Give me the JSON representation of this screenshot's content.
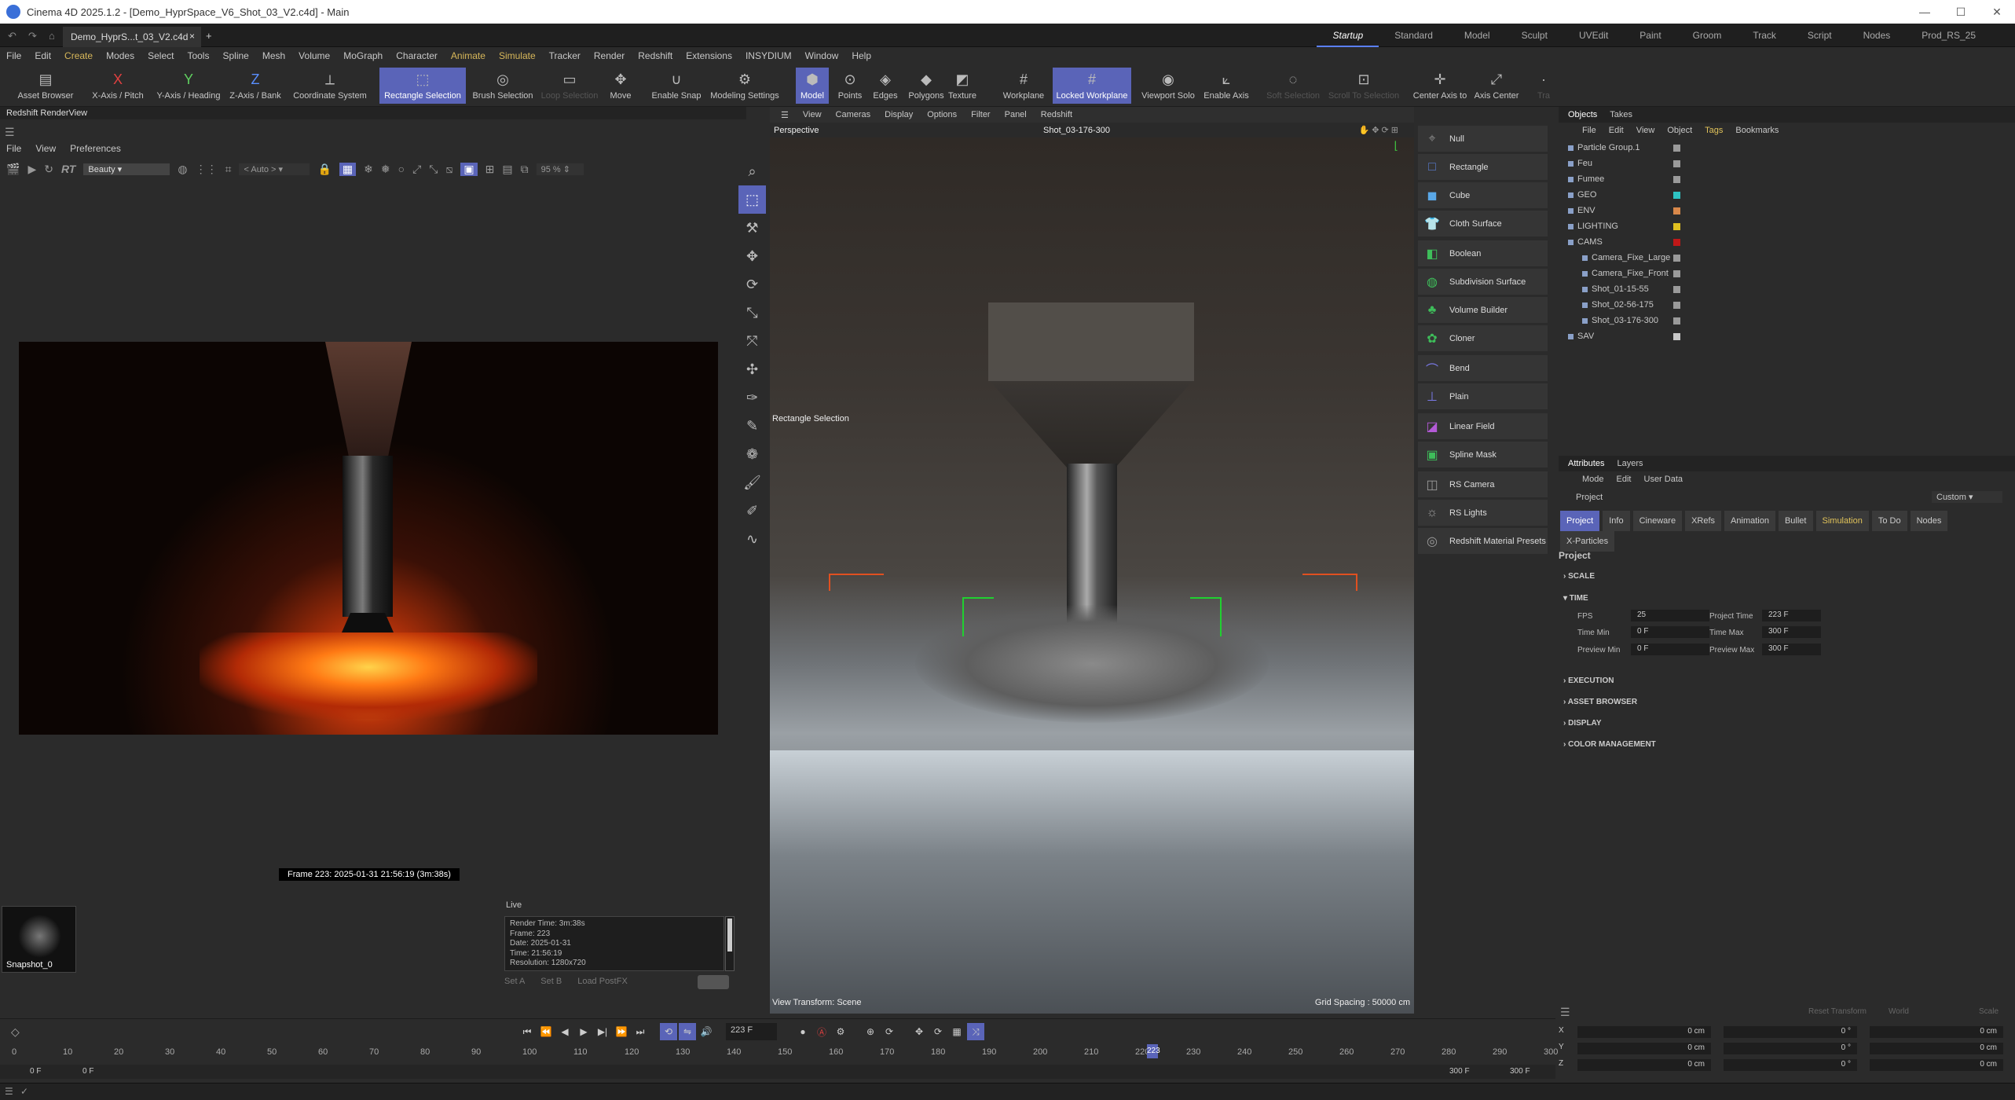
{
  "window": {
    "title": "Cinema 4D 2025.1.2 - [Demo_HyprSpace_V6_Shot_03_V2.c4d] - Main"
  },
  "doc_tab": {
    "label": "Demo_HyprS...t_03_V2.c4d",
    "close": "×",
    "add": "+"
  },
  "layouts": [
    "Startup",
    "Standard",
    "Model",
    "Sculpt",
    "UVEdit",
    "Paint",
    "Groom",
    "Track",
    "Script",
    "Nodes",
    "Prod_RS_25"
  ],
  "menu": [
    "File",
    "Edit",
    "Create",
    "Modes",
    "Select",
    "Tools",
    "Spline",
    "Mesh",
    "Volume",
    "MoGraph",
    "Character",
    "Animate",
    "Simulate",
    "Tracker",
    "Render",
    "Redshift",
    "Extensions",
    "INSYDIUM",
    "Window",
    "Help"
  ],
  "toolbar": [
    {
      "label": "Asset Browser",
      "icon": "asset-browser-icon",
      "glyph": "▤"
    },
    {
      "label": "X-Axis / Pitch",
      "icon": "x-axis-icon",
      "glyph": "X"
    },
    {
      "label": "Y-Axis / Heading",
      "icon": "y-axis-icon",
      "glyph": "Y"
    },
    {
      "label": "Z-Axis / Bank",
      "icon": "z-axis-icon",
      "glyph": "Z"
    },
    {
      "label": "Coordinate System",
      "icon": "coordinate-system-icon",
      "glyph": "⟂"
    },
    {
      "label": "Rectangle Selection",
      "icon": "rectangle-selection-icon",
      "glyph": "⬚"
    },
    {
      "label": "Brush Selection",
      "icon": "brush-selection-icon",
      "glyph": "◎"
    },
    {
      "label": "Loop Selection",
      "icon": "loop-selection-icon",
      "glyph": "▭"
    },
    {
      "label": "Move",
      "icon": "move-icon",
      "glyph": "✥"
    },
    {
      "label": "Enable Snap",
      "icon": "snap-icon",
      "glyph": "∪"
    },
    {
      "label": "Modeling Settings",
      "icon": "modeling-settings-icon",
      "glyph": "⚙"
    },
    {
      "label": "Model",
      "icon": "model-icon",
      "glyph": "⬢"
    },
    {
      "label": "Points",
      "icon": "points-icon",
      "glyph": "⊙"
    },
    {
      "label": "Edges",
      "icon": "edges-icon",
      "glyph": "◈"
    },
    {
      "label": "Polygons",
      "icon": "polygons-icon",
      "glyph": "◆"
    },
    {
      "label": "Texture",
      "icon": "texture-icon",
      "glyph": "◩"
    },
    {
      "label": "Workplane",
      "icon": "workplane-icon",
      "glyph": "#"
    },
    {
      "label": "Locked Workplane",
      "icon": "locked-workplane-icon",
      "glyph": "#"
    },
    {
      "label": "Viewport Solo",
      "icon": "viewport-solo-icon",
      "glyph": "◉"
    },
    {
      "label": "Enable Axis",
      "icon": "enable-axis-icon",
      "glyph": "⟀"
    },
    {
      "label": "Soft Selection",
      "icon": "soft-selection-icon",
      "glyph": "◌"
    },
    {
      "label": "Scroll To Selection",
      "icon": "scroll-to-selection-icon",
      "glyph": "⊡"
    },
    {
      "label": "Center Axis to",
      "icon": "center-axis-icon",
      "glyph": "✛"
    },
    {
      "label": "Axis Center",
      "icon": "axis-center-icon",
      "glyph": "⤢"
    },
    {
      "label": "Tra",
      "icon": "transfer-icon",
      "glyph": "·"
    }
  ],
  "renderview": {
    "title": "Redshift RenderView",
    "menu": [
      "File",
      "View",
      "Preferences"
    ],
    "rt": "RT",
    "aov": "Beauty",
    "auto": "< Auto >",
    "zoom": "95 %",
    "frame_caption": "Frame 223:  2025-01-31  21:56:19  (3m:38s)",
    "snapshot": "Snapshot_0",
    "live_label": "Live",
    "live_lines": [
      "Render Time: 3m:38s",
      "Frame: 223",
      "Date: 2025-01-31",
      "Time: 21:56:19",
      "Resolution: 1280x720"
    ],
    "live_buttons": [
      "Set A",
      "Set B",
      "Load PostFX"
    ]
  },
  "viewport": {
    "menu": [
      "View",
      "Cameras",
      "Display",
      "Options",
      "Filter",
      "Panel",
      "Redshift"
    ],
    "camera_name": "Perspective",
    "shot": "Shot_03-176-300",
    "tool_label": "Rectangle Selection",
    "view_transform": "View Transform: Scene",
    "grid_spacing": "Grid Spacing : 50000 cm"
  },
  "create_panel": [
    {
      "label": "Null",
      "icon": "null-icon",
      "color": "#8a8a8a",
      "glyph": "⌖"
    },
    {
      "label": "Rectangle",
      "icon": "rectangle-icon",
      "color": "#5a7fd8",
      "glyph": "□"
    },
    {
      "label": "Cube",
      "icon": "cube-icon",
      "color": "#5aa8e8",
      "glyph": "◼"
    },
    {
      "label": "Cloth Surface",
      "icon": "cloth-surface-icon",
      "color": "#3ebd5a",
      "glyph": "👕"
    },
    {
      "label": "Boolean",
      "icon": "boolean-icon",
      "color": "#3ebd5a",
      "glyph": "◧"
    },
    {
      "label": "Subdivision Surface",
      "icon": "subdivision-surface-icon",
      "color": "#3ebd5a",
      "glyph": "◍"
    },
    {
      "label": "Volume Builder",
      "icon": "volume-builder-icon",
      "color": "#3ebd5a",
      "glyph": "♣"
    },
    {
      "label": "Cloner",
      "icon": "cloner-icon",
      "color": "#3ebd5a",
      "glyph": "✿"
    },
    {
      "label": "Bend",
      "icon": "bend-icon",
      "color": "#7a7ae8",
      "glyph": "⌒"
    },
    {
      "label": "Plain",
      "icon": "plain-icon",
      "color": "#7a7ae8",
      "glyph": "⊥"
    },
    {
      "label": "Linear Field",
      "icon": "linear-field-icon",
      "color": "#b45ad8",
      "glyph": "◪"
    },
    {
      "label": "Spline Mask",
      "icon": "spline-mask-icon",
      "color": "#3ebd5a",
      "glyph": "▣"
    },
    {
      "label": "RS Camera",
      "icon": "rs-camera-icon",
      "color": "#9a9a9a",
      "glyph": "◫"
    },
    {
      "label": "RS Lights",
      "icon": "rs-lights-icon",
      "color": "#9a9a9a",
      "glyph": "☼"
    },
    {
      "label": "Redshift Material Presets",
      "icon": "material-presets-icon",
      "color": "#9a9a9a",
      "glyph": "◎"
    }
  ],
  "objects_panel": {
    "tabs": [
      "Objects",
      "Takes"
    ],
    "menu": [
      "File",
      "Edit",
      "View",
      "Object",
      "Tags",
      "Bookmarks"
    ],
    "items": [
      {
        "name": "Particle Group.1",
        "indent": 0,
        "color": "#9a9a9a"
      },
      {
        "name": "Feu",
        "indent": 0,
        "color": "#9a9a9a"
      },
      {
        "name": "Fumee",
        "indent": 0,
        "color": "#9a9a9a"
      },
      {
        "name": "GEO",
        "indent": 0,
        "color": "#2ec4c4"
      },
      {
        "name": "ENV",
        "indent": 0,
        "color": "#d8884a"
      },
      {
        "name": "LIGHTING",
        "indent": 0,
        "color": "#e0c020"
      },
      {
        "name": "CAMS",
        "indent": 0,
        "color": "#c01818"
      },
      {
        "name": "Camera_Fixe_Large",
        "indent": 1,
        "color": "#9a9a9a"
      },
      {
        "name": "Camera_Fixe_Front",
        "indent": 1,
        "color": "#9a9a9a"
      },
      {
        "name": "Shot_01-15-55",
        "indent": 1,
        "color": "#9a9a9a"
      },
      {
        "name": "Shot_02-56-175",
        "indent": 1,
        "color": "#9a9a9a"
      },
      {
        "name": "Shot_03-176-300",
        "indent": 1,
        "color": "#9a9a9a"
      },
      {
        "name": "SAV",
        "indent": 0,
        "color": "#c8c8c8"
      }
    ]
  },
  "attributes": {
    "tabs": [
      "Attributes",
      "Layers"
    ],
    "menu": [
      "Mode",
      "Edit",
      "User Data"
    ],
    "context": "Project",
    "preset": "Custom",
    "tags": [
      "Project",
      "Info",
      "Cineware",
      "XRefs",
      "Animation",
      "Bullet",
      "Simulation",
      "To Do",
      "Nodes",
      "X-Particles"
    ],
    "section_title": "Project",
    "sections": [
      "SCALE",
      "TIME",
      "EXECUTION",
      "ASSET BROWSER",
      "DISPLAY",
      "COLOR MANAGEMENT"
    ],
    "fields": {
      "fps_label": "FPS",
      "fps": "25",
      "project_time_label": "Project Time",
      "project_time": "223 F",
      "time_min_label": "Time Min",
      "time_min": "0 F",
      "time_max_label": "Time Max",
      "time_max": "300 F",
      "preview_min_label": "Preview Min",
      "preview_min": "0 F",
      "preview_max_label": "Preview Max",
      "preview_max": "300 F"
    }
  },
  "timeline": {
    "current_frame": "223 F",
    "ticks": [
      "0",
      "10",
      "20",
      "30",
      "40",
      "50",
      "60",
      "70",
      "80",
      "90",
      "100",
      "110",
      "120",
      "130",
      "140",
      "150",
      "160",
      "170",
      "180",
      "190",
      "200",
      "210",
      "220",
      "230",
      "240",
      "250",
      "260",
      "270",
      "280",
      "290",
      "300"
    ],
    "playhead_label": "223",
    "start": "0 F",
    "start2": "0 F",
    "end": "300 F",
    "end2": "300 F"
  },
  "coordinates": {
    "reset_transform": "Reset Transform",
    "space": "World",
    "mode": "Scale",
    "rows": [
      {
        "axis": "X",
        "pos": "0 cm",
        "rot": "0 °",
        "size": "0 cm"
      },
      {
        "axis": "Y",
        "pos": "0 cm",
        "rot": "0 °",
        "size": "0 cm"
      },
      {
        "axis": "Z",
        "pos": "0 cm",
        "rot": "0 °",
        "size": "0 cm"
      }
    ]
  }
}
